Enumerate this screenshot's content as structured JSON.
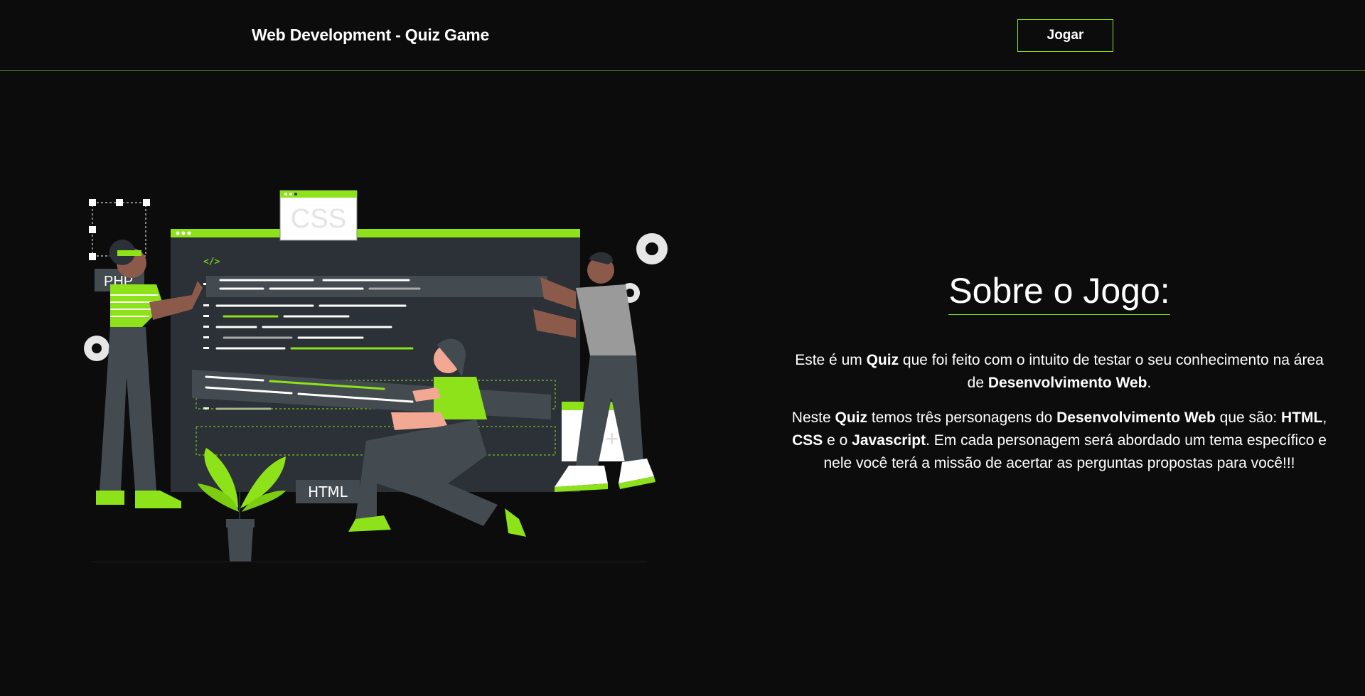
{
  "header": {
    "brand": "Web Development - Quiz Game",
    "play_button": "Jogar"
  },
  "illustration": {
    "css_window_label": "CSS",
    "php_tag": "PHP",
    "html_tag": "HTML",
    "code_icon": "</>",
    "cpp_card_label": "++"
  },
  "about": {
    "title": "Sobre o Jogo:",
    "p1": {
      "t1": "Este é um ",
      "b1": "Quiz",
      "t2": " que foi feito com o intuito de testar o seu conhecimento na área de ",
      "b2": "Desenvolvimento Web",
      "t3": "."
    },
    "p2": {
      "t1": "Neste ",
      "b1": "Quiz",
      "t2": " temos três personagens do ",
      "b2": "Desenvolvimento Web",
      "t3": " que são: ",
      "b3": "HTML",
      "t4": ", ",
      "b4": "CSS",
      "t5": " e o ",
      "b5": "Javascript",
      "t6": ". Em cada personagem será abordado um tema específico e nele você terá a missão de acertar as perguntas propostas para você!!!"
    }
  },
  "colors": {
    "background": "#0c0c0c",
    "accent": "#8ee21a",
    "panel": "#2b3136",
    "gray": "#434b51"
  }
}
